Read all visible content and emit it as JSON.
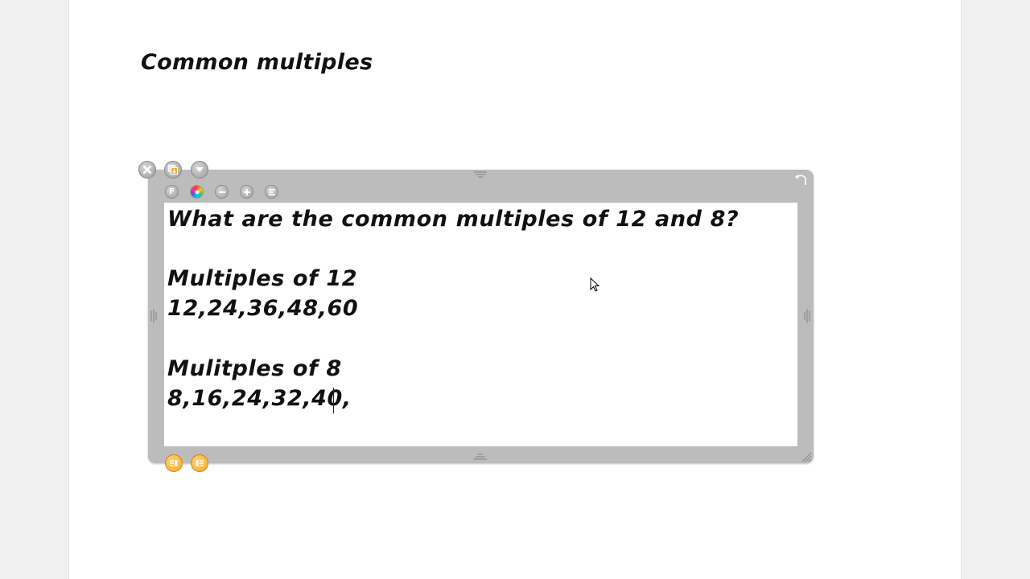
{
  "page": {
    "title": "Common multiples"
  },
  "textbox": {
    "lines": [
      "What are the common multiples of 12 and 8?",
      "Multiples of 12",
      "12,24,36,48,60",
      "Mulitples of 8",
      "8,16,24,32,40,"
    ],
    "font_button_letter": "F"
  },
  "icons": {
    "close": "close-icon",
    "duplicate": "duplicate-icon",
    "menu": "dropdown-arrow-icon",
    "font": "font-icon",
    "color": "color-wheel-icon",
    "decrease": "minus-icon",
    "increase": "plus-icon",
    "align": "align-icon",
    "rotate": "rotate-icon",
    "resize": "resize-corner-icon",
    "cursor": "mouse-pointer-icon"
  },
  "colors": {
    "frame": "#bcbcbc",
    "accent_orange": "#f5a623",
    "text": "#111111"
  }
}
